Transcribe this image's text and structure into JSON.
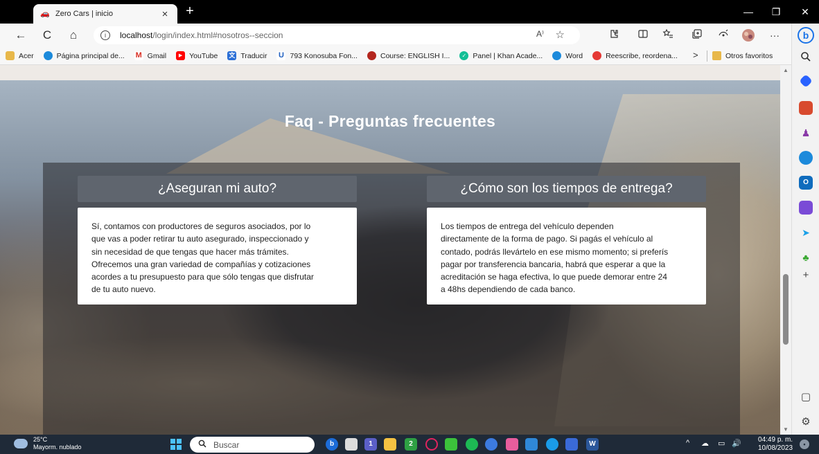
{
  "browser": {
    "tab": {
      "title": "Zero Cars | inicio",
      "close": "×"
    },
    "new_tab": "+",
    "window_controls": {
      "minimize": "—",
      "restore": "❐",
      "close": "✕"
    },
    "nav": {
      "back": "←",
      "reload": "C",
      "home": "⌂"
    },
    "url": {
      "host": "localhost",
      "path": "/login/index.html#nosotros--seccion",
      "read_aloud": "A⁾",
      "favorite": "☆"
    },
    "toolbar_icons": [
      "extensions-icon",
      "split-screen-icon",
      "favorites-icon",
      "collections-icon",
      "performance-icon",
      "profile-icon",
      "more-icon"
    ],
    "more": "···"
  },
  "bookmarks": [
    {
      "label": "Acer",
      "icon": "folder-icon"
    },
    {
      "label": "Página principal de...",
      "icon": "edge-icon"
    },
    {
      "label": "Gmail",
      "icon": "gmail-icon"
    },
    {
      "label": "YouTube",
      "icon": "youtube-icon"
    },
    {
      "label": "Traducir",
      "icon": "translate-icon"
    },
    {
      "label": "793 Konosuba Fon...",
      "icon": "site-icon"
    },
    {
      "label": "Course: ENGLISH I...",
      "icon": "course-icon"
    },
    {
      "label": "Panel | Khan Acade...",
      "icon": "khan-icon"
    },
    {
      "label": "Word",
      "icon": "word-icon"
    },
    {
      "label": "Reescribe, reordena...",
      "icon": "quillbot-icon"
    }
  ],
  "bookmarks_more": ">",
  "bookmarks_other": "Otros favoritos",
  "page": {
    "faq_title": "Faq - Preguntas frecuentes",
    "questions": [
      {
        "title": "¿Aseguran mi auto?",
        "lines": [
          "Sí, contamos con productores de seguros asociados, por lo",
          "que vas a poder retirar tu auto asegurado, inspeccionado y",
          "sin necesidad de que tengas que hacer más trámites.",
          "Ofrecemos una gran variedad de compañías y cotizaciones",
          "acordes a tu presupuesto para que sólo tengas que disfrutar",
          "de tu auto nuevo."
        ]
      },
      {
        "title": "¿Cómo son los tiempos de entrega?",
        "lines": [
          "Los tiempos de entrega del vehículo dependen",
          "directamente de la forma de pago. Si pagás el vehículo al",
          "contado, podrás llevártelo en ese mismo momento; si preferís",
          "pagar por transferencia bancaria, habrá que esperar a que la",
          "acreditación se haga efectiva, lo que puede demorar entre 24",
          "a 48hs dependiendo de cada banco."
        ]
      }
    ]
  },
  "sidebar": {
    "bing": "b",
    "add": "+",
    "split": "▢",
    "settings": "⚙"
  },
  "taskbar": {
    "weather": {
      "temp": "25°C",
      "desc": "Mayorm. nublado"
    },
    "search_placeholder": "Buscar",
    "tray_expand": "^",
    "clock": {
      "time": "04:49 p. m.",
      "date": "10/08/2023"
    },
    "badges": {
      "teams": "1",
      "xbox": "2"
    }
  },
  "colors": {
    "question_header": "#5f656e",
    "accent": "#1a73e8",
    "taskbar": "#1f2a38"
  }
}
